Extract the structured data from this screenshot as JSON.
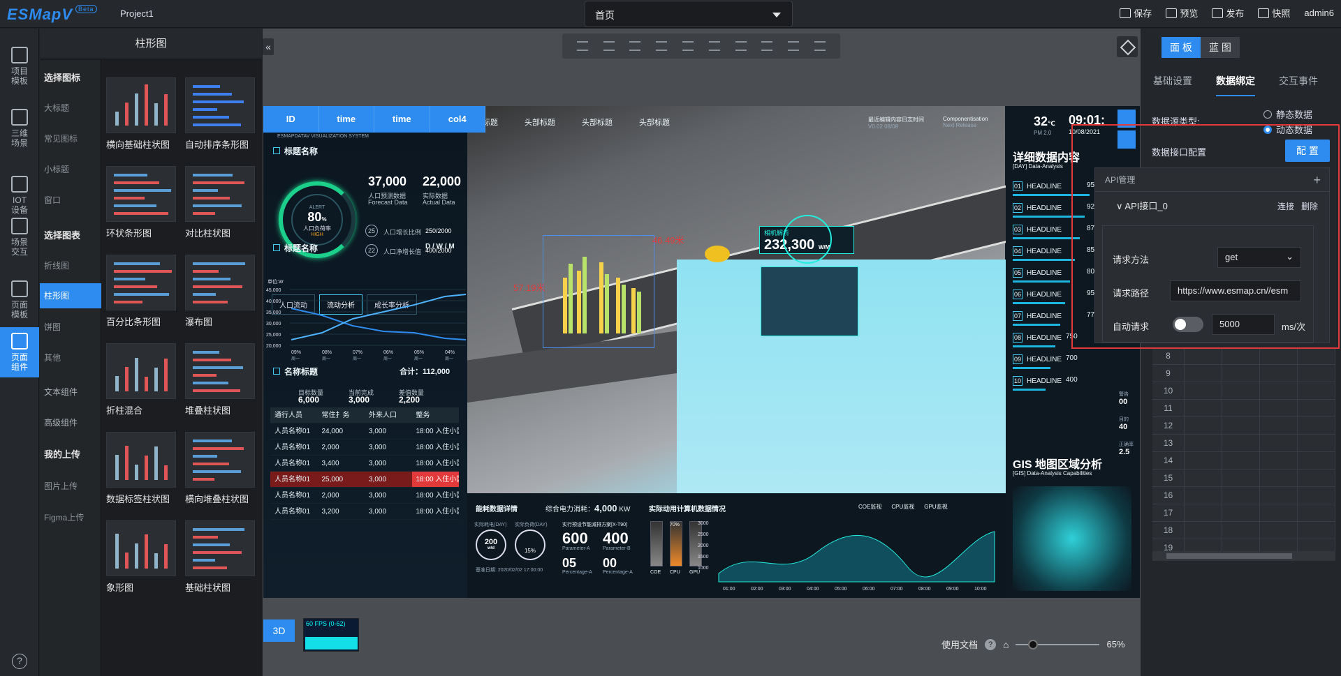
{
  "app": {
    "logo": "ESMapV",
    "beta": "Beta",
    "project": "Project1"
  },
  "page_select": {
    "value": "首页"
  },
  "top_actions": [
    {
      "label": "保存",
      "icon": "save-icon"
    },
    {
      "label": "预览",
      "icon": "preview-icon"
    },
    {
      "label": "发布",
      "icon": "publish-icon"
    },
    {
      "label": "快照",
      "icon": "camera-icon"
    },
    {
      "label": "admin6",
      "icon": ""
    }
  ],
  "left_nav": [
    {
      "label": "项目\n模板",
      "icon": "template-icon"
    },
    {
      "label": "三维\n场景",
      "icon": "building-icon"
    },
    {
      "label": "IOT\n设备",
      "icon": "cube-icon"
    },
    {
      "label": "场景\n交互",
      "icon": "sliders-icon"
    },
    {
      "label": "页面\n模板",
      "icon": "layout-icon"
    },
    {
      "label": "页面\n组件",
      "icon": "table-icon"
    }
  ],
  "catalog": {
    "title": "柱形图",
    "groups": [
      {
        "label": "选择图标",
        "items": [
          "大标题",
          "常见图标",
          "小标题",
          "窗口"
        ]
      },
      {
        "label": "选择图表",
        "items": [
          "折线图",
          "柱形图",
          "饼图",
          "其他"
        ]
      }
    ],
    "extra": [
      "文本组件",
      "高级组件"
    ],
    "upload": {
      "label": "我的上传",
      "items": [
        "图片上传",
        "Figma上传"
      ]
    },
    "active_item": "柱形图",
    "thumbs": [
      "横向基础柱状图",
      "自动排序条形图",
      "环状条形图",
      "对比柱状图",
      "百分比条形图",
      "瀑布图",
      "折柱混合",
      "堆叠柱状图",
      "数据标签柱状图",
      "横向堆叠柱状图",
      "象形图",
      "基础柱状图"
    ]
  },
  "screen": {
    "table_header": [
      "ID",
      "time",
      "time",
      "col4"
    ],
    "top_tabs": [
      "头部标题",
      "头部标题",
      "头部标题",
      "头部标题"
    ],
    "logo_sub": "ESMAPDATAV VISUALIZATION SYSTEM",
    "section1": "标题名称",
    "gauge": {
      "alert": "ALERT",
      "value": "80",
      "unit": "%",
      "label": "人口负荷率",
      "status": "HIGH"
    },
    "kpi": [
      {
        "value": "37,000",
        "label": "人口预测数据",
        "sub": "Forecast Data"
      },
      {
        "value": "22,000",
        "label": "实际数据",
        "sub": "Actual Data"
      }
    ],
    "ratios": [
      {
        "num": "25",
        "label": "人口增长比例",
        "value": "250/2000"
      },
      {
        "num": "22",
        "label": "人口净增长值",
        "value": "400/2000"
      }
    ],
    "section2": "标题名称",
    "section2_right": "D / W / M",
    "buttons": [
      "人口流动",
      "流动分析",
      "成长率分析"
    ],
    "line_chart": {
      "ylabel": "单位:W",
      "yticks": [
        "45,000",
        "40,000",
        "35,000",
        "30,000",
        "25,000",
        "20,000"
      ],
      "xticks": [
        "09%",
        "08%",
        "07%",
        "06%",
        "05%",
        "04%"
      ],
      "xsub": "周一"
    },
    "section3": "名称标题",
    "total": "合计：112,000",
    "stats": [
      {
        "label": "目标数量",
        "value": "6,000"
      },
      {
        "label": "当前完成",
        "value": "3,000"
      },
      {
        "label": "差值数量",
        "value": "2,200"
      }
    ],
    "people_table": {
      "headers": [
        "通行人员",
        "常住扌务",
        "外来人口",
        "整务"
      ],
      "rows": [
        [
          "人员名称01",
          "24,000",
          "3,000",
          "18:00 入住小区内部"
        ],
        [
          "人员名称01",
          "2,000",
          "3,000",
          "18:00 入住小区内部"
        ],
        [
          "人员名称01",
          "3,400",
          "3,000",
          "18:00 入住小区内部"
        ],
        [
          "人员名称01",
          "25,000",
          "3,000",
          "18:00 入住小区内部"
        ],
        [
          "人员名称01",
          "2,000",
          "3,000",
          "18:00 入住小区内部"
        ],
        [
          "人员名称01",
          "3,200",
          "3,000",
          "18:00 入住小区内部"
        ]
      ]
    },
    "overlay_labels": {
      "a": "46.49米",
      "b": "57.19米",
      "hud_title": "相机解析",
      "hud_value": "232,300",
      "hud_unit": "W/M"
    },
    "update": {
      "title": "最近编辑内容日志时间",
      "ver": "V0.02 08/08",
      "title2": "Componentisation",
      "sub2": "Next Release"
    },
    "weather": {
      "temp": "32",
      "unit": "℃",
      "pm": "PM 2.0",
      "time": "09:01:",
      "date": "10/08/2021"
    },
    "detail": {
      "title": "详细数据内容",
      "sub": "[DAY] Data-Analysis"
    },
    "headlines": [
      {
        "n": "01",
        "label": "HEADLINE",
        "value": "95"
      },
      {
        "n": "02",
        "label": "HEADLINE",
        "value": "92"
      },
      {
        "n": "03",
        "label": "HEADLINE",
        "value": "87"
      },
      {
        "n": "04",
        "label": "HEADLINE",
        "value": "85"
      },
      {
        "n": "05",
        "label": "HEADLINE",
        "value": "80"
      },
      {
        "n": "06",
        "label": "HEADLINE",
        "value": "95"
      },
      {
        "n": "07",
        "label": "HEADLINE",
        "value": "77"
      },
      {
        "n": "08",
        "label": "HEADLINE",
        "value": "750"
      },
      {
        "n": "09",
        "label": "HEADLINE",
        "value": "700"
      },
      {
        "n": "10",
        "label": "HEADLINE",
        "value": "400"
      }
    ],
    "side_stats": [
      {
        "label": "警告",
        "value": "00"
      },
      {
        "label": "目的",
        "value": "40"
      },
      {
        "label": "正确率",
        "value": "2.5"
      }
    ],
    "gis": {
      "title": "GIS 地图区域分析",
      "sub": "[GIS] Data-Analysis Capabilities"
    },
    "energy": {
      "title": "能耗数据详情",
      "total_label": "综合电力消耗：",
      "total": "4,000",
      "unit": "KW",
      "d1": "实际耗电(DAY)",
      "d2": "实际负荷(DAY)",
      "g1": "200",
      "g1u": "w/d",
      "g2": "15%",
      "plan": "实行预设节能减排方案[X-T90]",
      "p1": "600",
      "p1l": "Parameter-A",
      "p2": "400",
      "p2l": "Parameter-B",
      "pct1": "05",
      "pct1l": "Percentage-A",
      "pct2": "00",
      "pct2l": "Percentage-A",
      "date": "基准日期:  2020/02/02 17:00:00"
    },
    "compute": {
      "title": "实际动用计算机数据情况",
      "legend": [
        "COE监视",
        "CPU监视",
        "GPU监视"
      ],
      "bars": [
        "COE",
        "CPU",
        "GPU"
      ],
      "cpu_pct": "70%",
      "yticks": [
        "3000",
        "2500",
        "2000",
        "1500",
        "1000"
      ],
      "xticks": [
        "01:00",
        "02:00",
        "03:00",
        "04:00",
        "05:00",
        "06:00",
        "07:00",
        "08:00",
        "09:00",
        "10:00"
      ]
    }
  },
  "canvas_bottom": {
    "mode": "3D",
    "fps": "60 FPS (0-62)",
    "docs": "使用文档",
    "zoom": "65%",
    "zoom_level": 0.15
  },
  "right_panel": {
    "tabs": [
      "面 板",
      "蓝 图"
    ],
    "subtabs": [
      "基础设置",
      "数据绑定",
      "交互事件"
    ],
    "datasource_label": "数据源类型:",
    "radio_static": "静态数据",
    "radio_dynamic": "动态数据",
    "api_config_label": "数据接口配置",
    "config_btn": "配 置",
    "api_panel": {
      "title": "API管理",
      "item": "API接口_0",
      "connect": "连接",
      "delete": "删除",
      "method_label": "请求方法",
      "method": "get",
      "path_label": "请求路径",
      "path": "https://www.esmap.cn//esm",
      "auto_label": "自动请求",
      "interval": "5000",
      "interval_unit": "ms/次"
    },
    "grid_rows": [
      "8",
      "9",
      "10",
      "11",
      "12",
      "13",
      "14",
      "15",
      "16",
      "17",
      "18",
      "19"
    ]
  }
}
